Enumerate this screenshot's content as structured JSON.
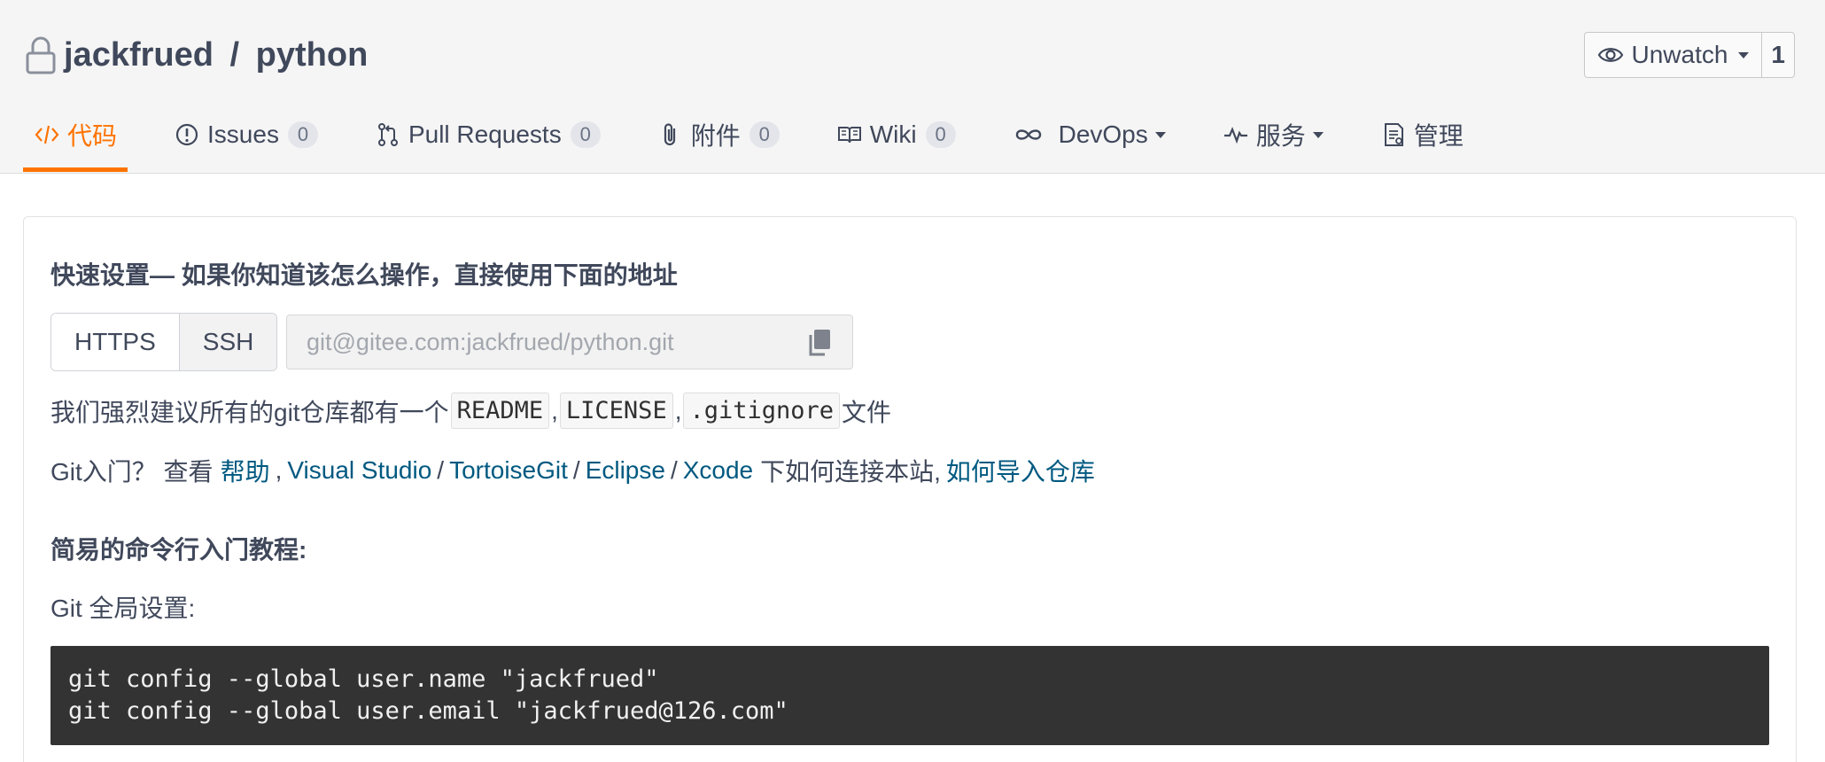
{
  "repo": {
    "owner": "jackfrued",
    "separator": " / ",
    "name": "python"
  },
  "watch": {
    "label": "Unwatch",
    "count": "1"
  },
  "tabs": [
    {
      "label": "代码",
      "icon": "code-icon",
      "badge": null,
      "active": true
    },
    {
      "label": "Issues",
      "icon": "issue-icon",
      "badge": "0"
    },
    {
      "label": "Pull Requests",
      "icon": "pull-request-icon",
      "badge": "0"
    },
    {
      "label": "附件",
      "icon": "paperclip-icon",
      "badge": "0"
    },
    {
      "label": "Wiki",
      "icon": "book-icon",
      "badge": "0"
    },
    {
      "label": "DevOps",
      "icon": "infinity-icon",
      "dropdown": true
    },
    {
      "label": "服务",
      "icon": "pulse-icon",
      "dropdown": true
    },
    {
      "label": "管理",
      "icon": "document-icon"
    }
  ],
  "quick_setup": {
    "title": "快速设置— 如果你知道该怎么操作，直接使用下面的地址",
    "protocols": [
      "HTTPS",
      "SSH"
    ],
    "url_value": "git@gitee.com:jackfrued/python.git"
  },
  "recommend": {
    "prefix": "我们强烈建议所有的git仓库都有一个",
    "files": [
      "README",
      "LICENSE",
      ".gitignore"
    ],
    "comma": ",",
    "suffix": "文件"
  },
  "git_intro": {
    "prefix": "Git入门？ 查看",
    "help": "帮助",
    "comma": ",",
    "tools": [
      "Visual Studio",
      "TortoiseGit",
      "Eclipse",
      "Xcode"
    ],
    "slash": "/",
    "middle": "下如何连接本站,",
    "import_link": "如何导入仓库"
  },
  "tutorial": {
    "title": "简易的命令行入门教程:",
    "global_label": "Git 全局设置:",
    "code_lines": [
      "git config --global user.name \"jackfrued\"",
      "git config --global user.email \"jackfrued@126.com\""
    ]
  },
  "colors": {
    "accent": "#fe7300",
    "link": "#005980",
    "code_bg": "#333333"
  }
}
